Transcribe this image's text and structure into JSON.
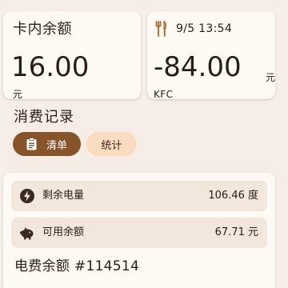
{
  "balance_card": {
    "title": "卡内余额",
    "amount": "16.00",
    "unit": "元"
  },
  "last_transaction": {
    "icon": "fork-knife-icon",
    "datetime": "9/5 13:54",
    "amount": "-84.00",
    "unit": "元",
    "merchant": "KFC"
  },
  "records": {
    "title": "消费记录",
    "chips": [
      {
        "label": "清单",
        "icon": "clipboard-icon",
        "selected": true
      },
      {
        "label": "统计",
        "selected": false
      }
    ]
  },
  "electricity": {
    "rows": [
      {
        "icon": "bolt-icon",
        "label": "剩余电量",
        "value": "106.46 度"
      },
      {
        "icon": "piggy-bank-icon",
        "label": "可用余额",
        "value": "67.71 元"
      }
    ],
    "title": "电费余额 #114514"
  },
  "colors": {
    "background": "#f6ede7",
    "card": "#fff8f3",
    "primary": "#865428",
    "chip_unselected": "#fcdcc0",
    "row_background": "#f2e6dd",
    "text": "#2b1d16"
  }
}
